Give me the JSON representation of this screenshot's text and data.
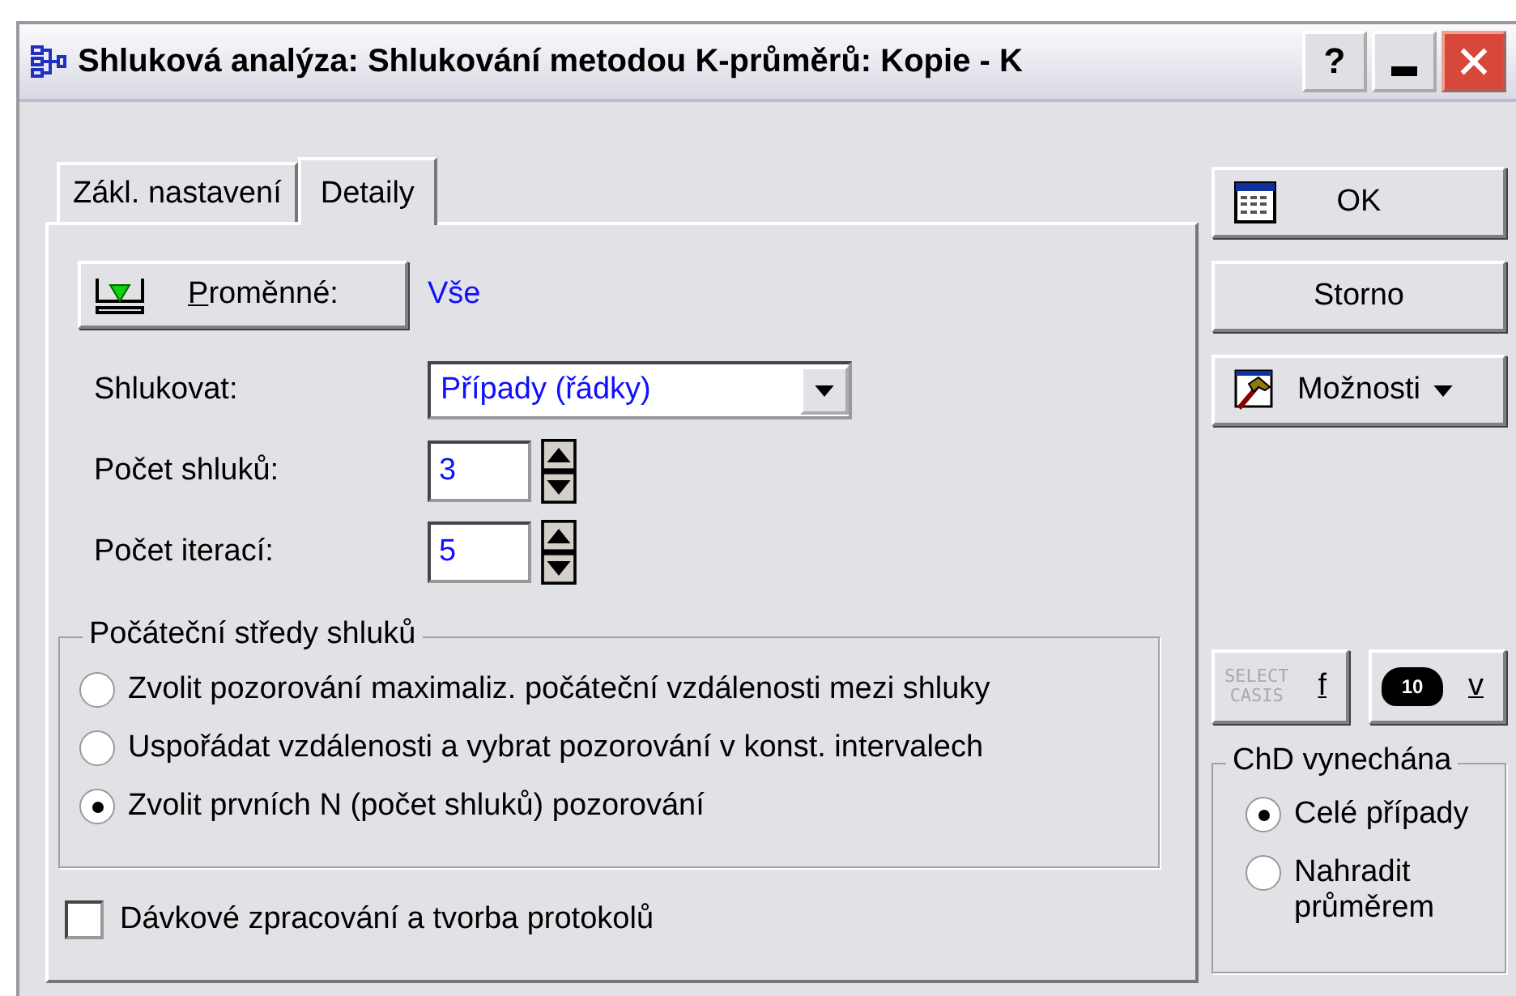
{
  "window": {
    "title": "Shluková analýza: Shlukování metodou K-průměrů: Kopie - K",
    "controls": [
      "?"
    ]
  },
  "tabs": [
    {
      "label": "Zákl. nastavení",
      "selected": false
    },
    {
      "label": "Detaily",
      "selected": true
    }
  ],
  "variables": {
    "button": "Proměnné:",
    "value": "Vše"
  },
  "cluster_by": {
    "label": "Shlukovat:",
    "value": "Případy (řádky)"
  },
  "spinners": [
    {
      "label": "Počet shluků:",
      "value": "3"
    },
    {
      "label": "Počet iterací:",
      "value": "5"
    }
  ],
  "initial_centers": {
    "title": "Počáteční středy shluků",
    "options": [
      {
        "label": "Zvolit pozorování maximaliz. počáteční vzdálenosti mezi shluky",
        "selected": false
      },
      {
        "label": "Uspořádat vzdálenosti a vybrat pozorování v konst. intervalech",
        "selected": false
      },
      {
        "label": "Zvolit prvních N (počet shluků) pozorování",
        "selected": true
      }
    ]
  },
  "batch": {
    "label": "Dávkové zpracování a tvorba protokolů",
    "checked": false
  },
  "buttons": [
    {
      "label": "OK",
      "kind": "ok"
    },
    {
      "label": "Storno",
      "kind": "plain"
    },
    {
      "label": "Možnosti",
      "kind": "menu"
    }
  ],
  "small_buttons": [
    {
      "kind": "select",
      "icon_text": [
        "SELECT",
        "CASIS"
      ],
      "label": "f",
      "disabled": true
    },
    {
      "kind": "weight",
      "icon_text": [
        "10"
      ],
      "label": "v",
      "disabled": false
    }
  ],
  "missing_data": {
    "title": "ChD vynechána",
    "options": [
      {
        "label": "Celé případy",
        "selected": true
      },
      {
        "label": "Nahradit průměrem",
        "selected": false
      }
    ]
  }
}
